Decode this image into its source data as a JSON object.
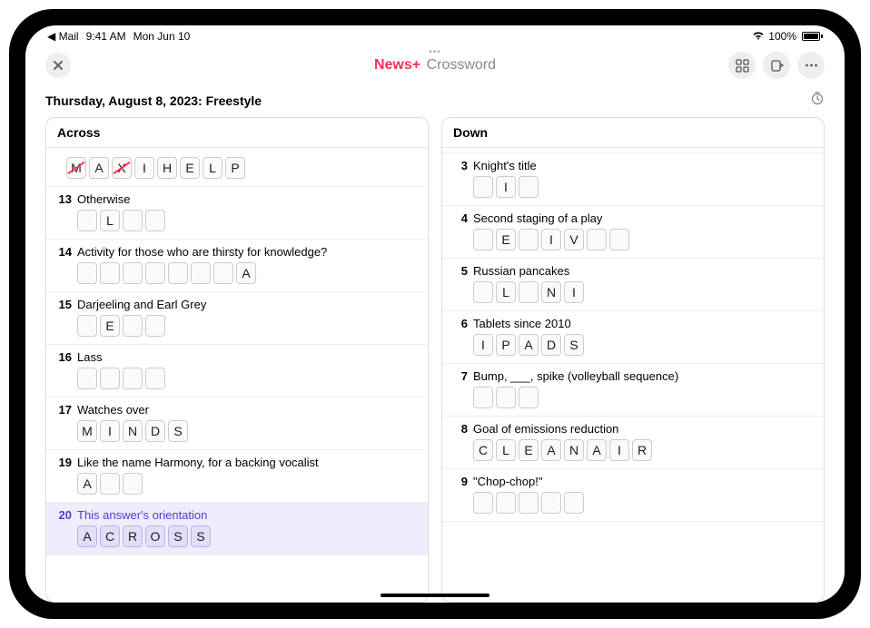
{
  "status": {
    "back_app": "Mail",
    "time": "9:41 AM",
    "date": "Mon Jun 10",
    "battery_pct": "100%"
  },
  "nav": {
    "brand_text": "News",
    "brand_plus": "+",
    "title_suffix": "Crossword"
  },
  "puzzle": {
    "title": "Thursday, August 8, 2023: Freestyle"
  },
  "across": {
    "label": "Across",
    "top_cells": [
      {
        "l": "M",
        "struck": true
      },
      {
        "l": "A"
      },
      {
        "l": "X",
        "struck": true
      },
      {
        "l": "I"
      },
      {
        "l": "H"
      },
      {
        "l": "E"
      },
      {
        "l": "L"
      },
      {
        "l": "P"
      }
    ],
    "clues": [
      {
        "num": "13",
        "text": "Otherwise",
        "cells": [
          {
            "l": ""
          },
          {
            "l": "L"
          },
          {
            "l": ""
          },
          {
            "l": ""
          }
        ]
      },
      {
        "num": "14",
        "text": "Activity for those who are thirsty for knowledge?",
        "cells": [
          {
            "l": ""
          },
          {
            "l": ""
          },
          {
            "l": ""
          },
          {
            "l": ""
          },
          {
            "l": ""
          },
          {
            "l": ""
          },
          {
            "l": ""
          },
          {
            "l": "A"
          }
        ]
      },
      {
        "num": "15",
        "text": "Darjeeling and Earl Grey",
        "cells": [
          {
            "l": ""
          },
          {
            "l": "E"
          },
          {
            "l": ""
          },
          {
            "l": ""
          }
        ]
      },
      {
        "num": "16",
        "text": "Lass",
        "cells": [
          {
            "l": ""
          },
          {
            "l": ""
          },
          {
            "l": ""
          },
          {
            "l": ""
          }
        ]
      },
      {
        "num": "17",
        "text": "Watches over",
        "cells": [
          {
            "l": "M"
          },
          {
            "l": "I"
          },
          {
            "l": "N"
          },
          {
            "l": "D"
          },
          {
            "l": "S"
          }
        ]
      },
      {
        "num": "19",
        "text": "Like the name Harmony, for a backing vocalist",
        "cells": [
          {
            "l": "A"
          },
          {
            "l": ""
          },
          {
            "l": ""
          }
        ]
      },
      {
        "num": "20",
        "text": "This answer's orientation",
        "active": true,
        "cells": [
          {
            "l": "A",
            "a": true
          },
          {
            "l": "C",
            "a": true
          },
          {
            "l": "R",
            "a": true
          },
          {
            "l": "O",
            "a": true
          },
          {
            "l": "S",
            "a": true
          },
          {
            "l": "S",
            "a": true
          }
        ]
      }
    ]
  },
  "down": {
    "label": "Down",
    "clues": [
      {
        "num": "3",
        "text": "Knight's title",
        "cells": [
          {
            "l": ""
          },
          {
            "l": "I"
          },
          {
            "l": ""
          }
        ]
      },
      {
        "num": "4",
        "text": "Second staging of a play",
        "cells": [
          {
            "l": ""
          },
          {
            "l": "E"
          },
          {
            "l": ""
          },
          {
            "l": "I"
          },
          {
            "l": "V"
          },
          {
            "l": ""
          },
          {
            "l": ""
          }
        ]
      },
      {
        "num": "5",
        "text": "Russian pancakes",
        "cells": [
          {
            "l": ""
          },
          {
            "l": "L"
          },
          {
            "l": ""
          },
          {
            "l": "N"
          },
          {
            "l": "I"
          }
        ]
      },
      {
        "num": "6",
        "text": "Tablets since 2010",
        "cells": [
          {
            "l": "I"
          },
          {
            "l": "P"
          },
          {
            "l": "A"
          },
          {
            "l": "D"
          },
          {
            "l": "S"
          }
        ]
      },
      {
        "num": "7",
        "text": "Bump, ___, spike (volleyball sequence)",
        "cells": [
          {
            "l": ""
          },
          {
            "l": ""
          },
          {
            "l": ""
          }
        ]
      },
      {
        "num": "8",
        "text": "Goal of emissions reduction",
        "cells": [
          {
            "l": "C"
          },
          {
            "l": "L"
          },
          {
            "l": "E"
          },
          {
            "l": "A"
          },
          {
            "l": "N"
          },
          {
            "l": "A"
          },
          {
            "l": "I"
          },
          {
            "l": "R"
          }
        ]
      },
      {
        "num": "9",
        "text": "\"Chop-chop!\"",
        "cells": [
          {
            "l": ""
          },
          {
            "l": ""
          },
          {
            "l": ""
          },
          {
            "l": ""
          },
          {
            "l": ""
          }
        ]
      }
    ]
  }
}
